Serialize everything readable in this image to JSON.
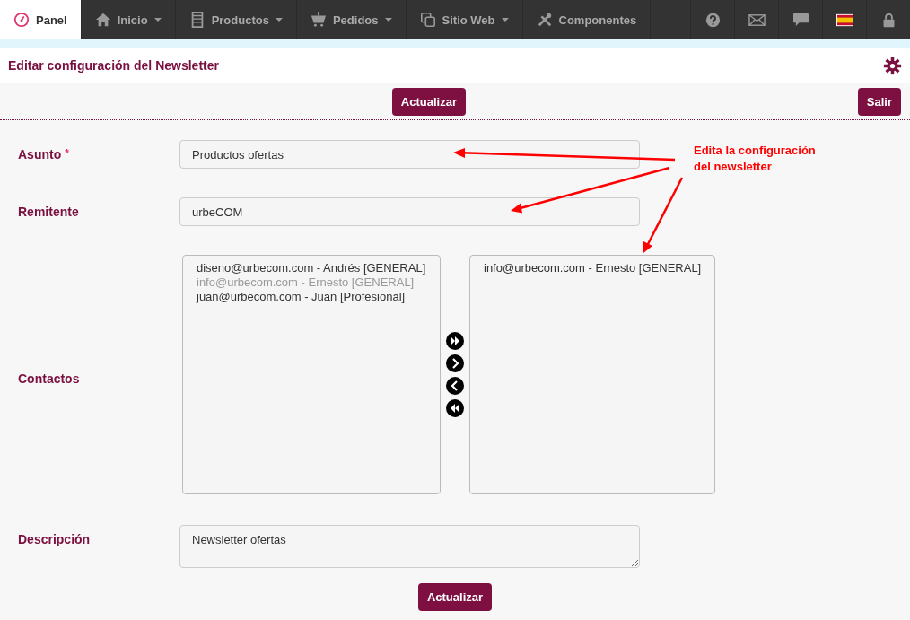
{
  "nav": {
    "items": [
      {
        "label": "Panel",
        "selected": true,
        "dropdown": false
      },
      {
        "label": "Inicio",
        "selected": false,
        "dropdown": true
      },
      {
        "label": "Productos",
        "selected": false,
        "dropdown": true
      },
      {
        "label": "Pedidos",
        "selected": false,
        "dropdown": true
      },
      {
        "label": "Sitio Web",
        "selected": false,
        "dropdown": true
      },
      {
        "label": "Componentes",
        "selected": false,
        "dropdown": false
      }
    ],
    "right_icons": [
      {
        "kind": "help"
      },
      {
        "kind": "mail"
      },
      {
        "kind": "chat"
      },
      {
        "kind": "flag"
      },
      {
        "kind": "lock"
      }
    ]
  },
  "page": {
    "title": "Editar configuración del Newsletter"
  },
  "toolbar": {
    "update_button": "Actualizar",
    "exit_button": "Salir"
  },
  "form": {
    "fields": [
      {
        "kind": "text",
        "label": "Asunto",
        "required_mark": "*",
        "value": "Productos ofertas"
      },
      {
        "kind": "text",
        "label": "Remitente",
        "value": "urbeCOM"
      },
      {
        "kind": "dual_list",
        "label": "Contactos",
        "available": [
          {
            "text": "diseno@urbecom.com - Andrés [GENERAL]",
            "disabled": false
          },
          {
            "text": "info@urbecom.com - Ernesto [GENERAL]",
            "disabled": true
          },
          {
            "text": "juan@urbecom.com - Juan [Profesional]",
            "disabled": false
          }
        ],
        "chosen": [
          {
            "text": "info@urbecom.com - Ernesto [GENERAL]",
            "disabled": false
          }
        ]
      },
      {
        "kind": "textarea",
        "label": "Descripción",
        "value": "Newsletter ofertas"
      }
    ],
    "submit_button": "Actualizar"
  },
  "annotation": {
    "lines": [
      "Edita la configuración",
      "del newsletter"
    ]
  }
}
